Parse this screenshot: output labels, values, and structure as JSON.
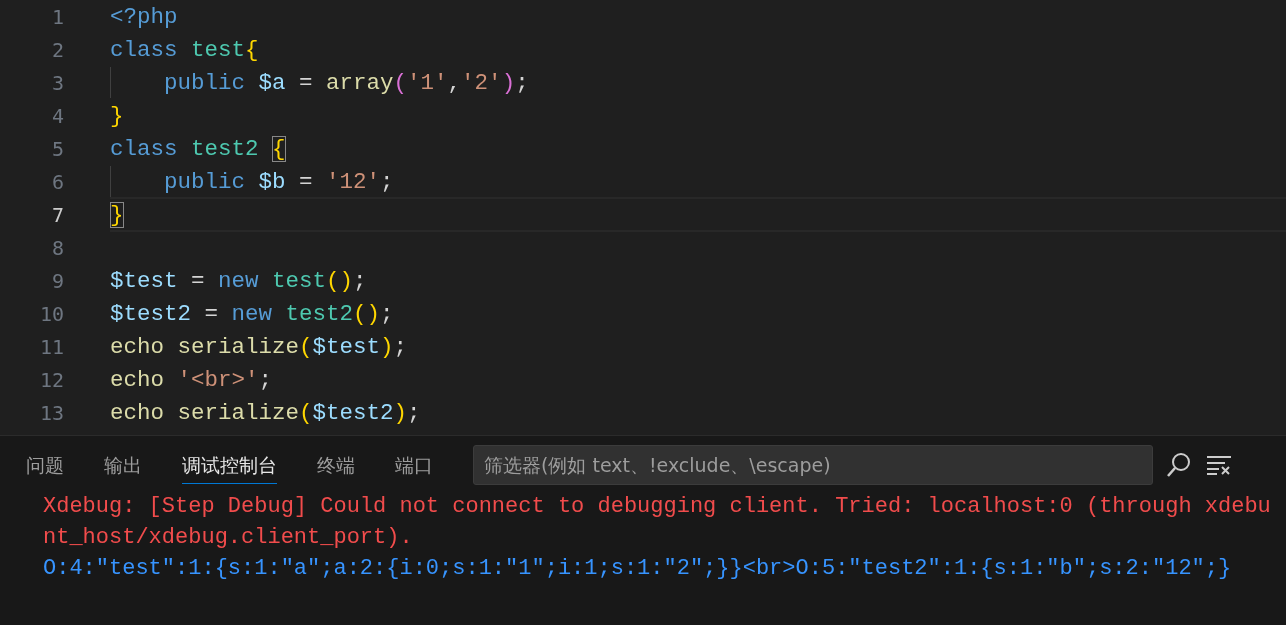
{
  "editor": {
    "lines": [
      {
        "number": "1",
        "current": false,
        "indented": false,
        "tokens": [
          {
            "text": "<?php",
            "kind": "keyword"
          }
        ]
      },
      {
        "number": "2",
        "current": false,
        "indented": false,
        "tokens": [
          {
            "text": "class ",
            "kind": "keyword"
          },
          {
            "text": "test",
            "kind": "class"
          },
          {
            "text": "{",
            "kind": "brace"
          }
        ]
      },
      {
        "number": "3",
        "current": false,
        "indented": true,
        "tokens": [
          {
            "text": "public ",
            "kind": "keyword"
          },
          {
            "text": "$a",
            "kind": "variable"
          },
          {
            "text": " = ",
            "kind": "plain"
          },
          {
            "text": "array",
            "kind": "function"
          },
          {
            "text": "(",
            "kind": "paren"
          },
          {
            "text": "'1'",
            "kind": "string"
          },
          {
            "text": ",",
            "kind": "plain"
          },
          {
            "text": "'2'",
            "kind": "string"
          },
          {
            "text": ")",
            "kind": "paren"
          },
          {
            "text": ";",
            "kind": "plain"
          }
        ]
      },
      {
        "number": "4",
        "current": false,
        "indented": false,
        "tokens": [
          {
            "text": "}",
            "kind": "brace"
          }
        ]
      },
      {
        "number": "5",
        "current": false,
        "indented": false,
        "tokens": [
          {
            "text": "class ",
            "kind": "keyword"
          },
          {
            "text": "test2 ",
            "kind": "class"
          },
          {
            "text": "{",
            "kind": "brace-matched"
          }
        ]
      },
      {
        "number": "6",
        "current": false,
        "indented": true,
        "tokens": [
          {
            "text": "public ",
            "kind": "keyword"
          },
          {
            "text": "$b",
            "kind": "variable"
          },
          {
            "text": " = ",
            "kind": "plain"
          },
          {
            "text": "'12'",
            "kind": "string"
          },
          {
            "text": ";",
            "kind": "plain"
          }
        ]
      },
      {
        "number": "7",
        "current": true,
        "indented": false,
        "tokens": [
          {
            "text": "}",
            "kind": "brace-matched"
          }
        ]
      },
      {
        "number": "8",
        "current": false,
        "indented": false
      },
      {
        "number": "9",
        "current": false,
        "indented": false,
        "tokens": [
          {
            "text": "$test",
            "kind": "variable"
          },
          {
            "text": " = ",
            "kind": "plain"
          },
          {
            "text": "new ",
            "kind": "keyword"
          },
          {
            "text": "test",
            "kind": "class"
          },
          {
            "text": "()",
            "kind": "brace"
          },
          {
            "text": ";",
            "kind": "plain"
          }
        ]
      },
      {
        "number": "10",
        "current": false,
        "indented": false,
        "tokens": [
          {
            "text": "$test2",
            "kind": "variable"
          },
          {
            "text": " = ",
            "kind": "plain"
          },
          {
            "text": "new ",
            "kind": "keyword"
          },
          {
            "text": "test2",
            "kind": "class"
          },
          {
            "text": "()",
            "kind": "brace"
          },
          {
            "text": ";",
            "kind": "plain"
          }
        ]
      },
      {
        "number": "11",
        "current": false,
        "indented": false,
        "tokens": [
          {
            "text": "echo ",
            "kind": "function"
          },
          {
            "text": "serialize",
            "kind": "function"
          },
          {
            "text": "(",
            "kind": "brace"
          },
          {
            "text": "$test",
            "kind": "variable"
          },
          {
            "text": ")",
            "kind": "brace"
          },
          {
            "text": ";",
            "kind": "plain"
          }
        ]
      },
      {
        "number": "12",
        "current": false,
        "indented": false,
        "tokens": [
          {
            "text": "echo ",
            "kind": "function"
          },
          {
            "text": "'<br>'",
            "kind": "string"
          },
          {
            "text": ";",
            "kind": "plain"
          }
        ]
      },
      {
        "number": "13",
        "current": false,
        "indented": false,
        "tokens": [
          {
            "text": "echo ",
            "kind": "function"
          },
          {
            "text": "serialize",
            "kind": "function"
          },
          {
            "text": "(",
            "kind": "brace"
          },
          {
            "text": "$test2",
            "kind": "variable"
          },
          {
            "text": ")",
            "kind": "brace"
          },
          {
            "text": ";",
            "kind": "plain"
          }
        ]
      }
    ]
  },
  "panel": {
    "tabs": [
      {
        "label": "问题",
        "selected": false
      },
      {
        "label": "输出",
        "selected": false
      },
      {
        "label": "调试控制台",
        "selected": true
      },
      {
        "label": "终端",
        "selected": false
      },
      {
        "label": "端口",
        "selected": false
      }
    ],
    "filter": {
      "placeholder": "筛选器(例如 text、!exclude、\\escape)"
    },
    "output": [
      {
        "text": "Xdebug: [Step Debug] Could not connect to debugging client. Tried: localhost:0 (through xdebu",
        "kind": "error"
      },
      {
        "text": "nt_host/xdebug.client_port).",
        "kind": "error"
      },
      {
        "text": "O:4:\"test\":1:{s:1:\"a\";a:2:{i:0;s:1:\"1\";i:1;s:1:\"2\";}}<br>O:5:\"test2\":1:{s:1:\"b\";s:2:\"12\";}",
        "kind": "info"
      }
    ]
  }
}
